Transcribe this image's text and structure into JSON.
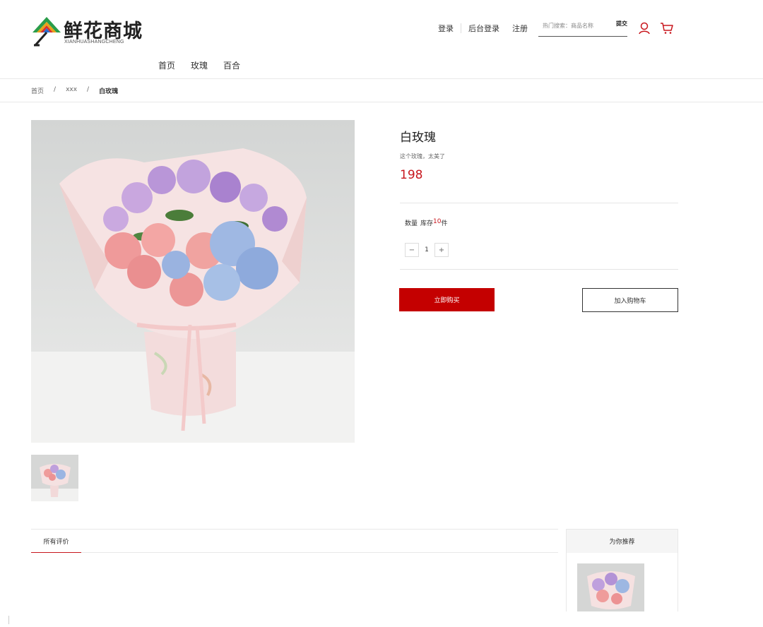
{
  "brand": {
    "title": "鲜花商城",
    "subtitle": "XIANHUASHANGCHENG",
    "logo_icon": "tent-triangle-logo"
  },
  "nav": {
    "items": [
      {
        "label": "首页"
      },
      {
        "label": "玫瑰"
      },
      {
        "label": "百合"
      }
    ]
  },
  "top_links": {
    "login": "登录",
    "admin_login": "后台登录",
    "register": "注册"
  },
  "search": {
    "placeholder": "热门搜索：商品名称",
    "submit_label": "提交"
  },
  "icons": {
    "user": "user-icon",
    "cart": "cart-icon"
  },
  "breadcrumb": {
    "home": "首页",
    "middle": "xxx",
    "current": "白玫瑰",
    "separator": "/"
  },
  "product": {
    "name": "白玫瑰",
    "description": "这个玫瑰，太美了",
    "price": "198",
    "quantity_label": "数量",
    "stock_prefix": "库存",
    "stock_count": "10",
    "stock_suffix": "件",
    "quantity_value": "1",
    "minus": "−",
    "plus": "+",
    "buy_now": "立即购买",
    "add_to_cart": "加入购物车"
  },
  "reviews": {
    "tab_label": "所有评价"
  },
  "recommend": {
    "title": "为你推荐"
  },
  "colors": {
    "accent": "#c8161d",
    "button": "#c40000",
    "divider": "#e8e8e8"
  }
}
